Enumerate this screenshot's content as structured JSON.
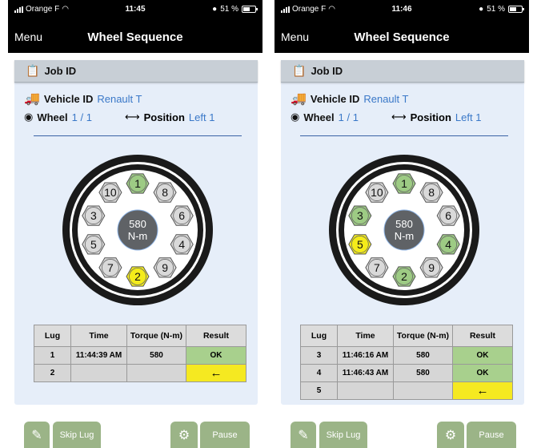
{
  "phones": [
    {
      "status": {
        "carrier": "Orange F",
        "time": "11:45",
        "battery": "51 %",
        "battery_level": 0.51
      },
      "nav": {
        "menu_label": "Menu",
        "title": "Wheel Sequence"
      },
      "job": {
        "label": "Job ID"
      },
      "vehicle": {
        "label": "Vehicle ID",
        "value": "Renault T"
      },
      "wheel": {
        "label": "Wheel",
        "value": "1 / 1"
      },
      "position": {
        "label": "Position",
        "value": "Left 1"
      },
      "hub": {
        "value": "580",
        "unit": "N-m"
      },
      "lugs": [
        {
          "n": "1",
          "state": "done"
        },
        {
          "n": "8",
          "state": "idle"
        },
        {
          "n": "6",
          "state": "idle"
        },
        {
          "n": "4",
          "state": "idle"
        },
        {
          "n": "9",
          "state": "idle"
        },
        {
          "n": "2",
          "state": "active"
        },
        {
          "n": "7",
          "state": "idle"
        },
        {
          "n": "5",
          "state": "idle"
        },
        {
          "n": "3",
          "state": "idle"
        },
        {
          "n": "10",
          "state": "idle"
        }
      ],
      "table": {
        "headers": [
          "Lug",
          "Time",
          "Torque (N-m)",
          "Result"
        ],
        "rows": [
          {
            "lug": "1",
            "time": "11:44:39 AM",
            "torque": "580",
            "result": "OK",
            "status": "ok"
          },
          {
            "lug": "2",
            "time": "",
            "torque": "",
            "result": "←",
            "status": "pending"
          }
        ]
      },
      "buttons": {
        "skip": "Skip Lug",
        "pause": "Pause"
      }
    },
    {
      "status": {
        "carrier": "Orange F",
        "time": "11:46",
        "battery": "51 %",
        "battery_level": 0.51
      },
      "nav": {
        "menu_label": "Menu",
        "title": "Wheel Sequence"
      },
      "job": {
        "label": "Job ID"
      },
      "vehicle": {
        "label": "Vehicle ID",
        "value": "Renault T"
      },
      "wheel": {
        "label": "Wheel",
        "value": "1 / 1"
      },
      "position": {
        "label": "Position",
        "value": "Left 1"
      },
      "hub": {
        "value": "580",
        "unit": "N-m"
      },
      "lugs": [
        {
          "n": "1",
          "state": "done"
        },
        {
          "n": "8",
          "state": "idle"
        },
        {
          "n": "6",
          "state": "idle"
        },
        {
          "n": "4",
          "state": "done"
        },
        {
          "n": "9",
          "state": "idle"
        },
        {
          "n": "2",
          "state": "done"
        },
        {
          "n": "7",
          "state": "idle"
        },
        {
          "n": "5",
          "state": "active"
        },
        {
          "n": "3",
          "state": "done"
        },
        {
          "n": "10",
          "state": "idle"
        }
      ],
      "table": {
        "headers": [
          "Lug",
          "Time",
          "Torque (N-m)",
          "Result"
        ],
        "rows": [
          {
            "lug": "3",
            "time": "11:46:16 AM",
            "torque": "580",
            "result": "OK",
            "status": "ok"
          },
          {
            "lug": "4",
            "time": "11:46:43 AM",
            "torque": "580",
            "result": "OK",
            "status": "ok"
          },
          {
            "lug": "5",
            "time": "",
            "torque": "",
            "result": "←",
            "status": "pending"
          }
        ]
      },
      "buttons": {
        "skip": "Skip Lug",
        "pause": "Pause"
      }
    }
  ],
  "colors": {
    "done": "#9dcb84",
    "active": "#f4ec1a",
    "idle": "#d9d9d9",
    "hub": "#5f6266"
  }
}
